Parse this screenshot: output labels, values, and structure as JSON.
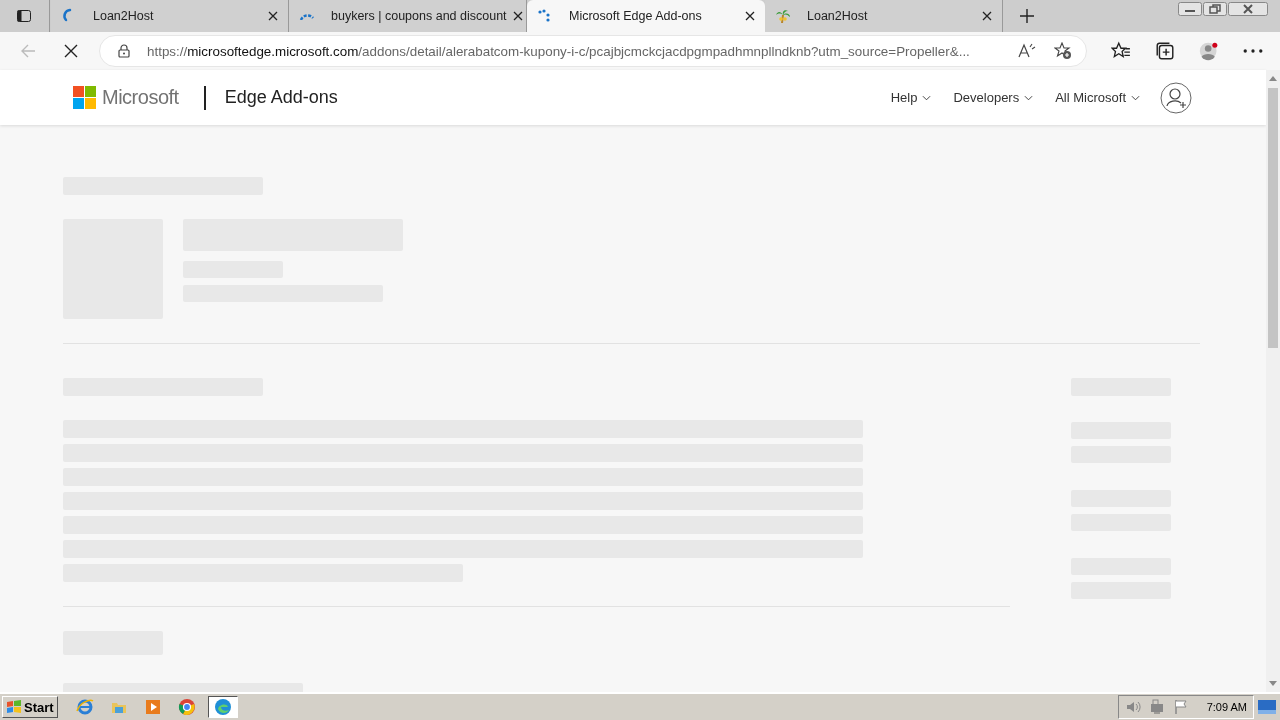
{
  "browser": {
    "tabs": [
      {
        "title": "Loan2Host",
        "selected": false
      },
      {
        "title": "buykers | coupons and discount",
        "selected": false
      },
      {
        "title": "Microsoft Edge Add-ons",
        "selected": true
      },
      {
        "title": "Loan2Host",
        "selected": false
      }
    ],
    "loading": true,
    "address": {
      "scheme": "https://",
      "host": "microsoftedge.microsoft.com",
      "path": "/addons/detail/alerabatcom-kupony-i-c/pcajbjcmckcjacdpgmpadhmnpllndknb?utm_source=Propeller&..."
    }
  },
  "header": {
    "brand": "Microsoft",
    "product": "Edge Add-ons",
    "menus": [
      "Help",
      "Developers",
      "All Microsoft"
    ]
  },
  "taskbar": {
    "start": "Start",
    "apps": [
      {
        "selected": false
      },
      {
        "selected": false
      },
      {
        "selected": false
      },
      {
        "selected": false
      },
      {
        "selected": true
      }
    ],
    "clock": "7:09 AM"
  }
}
